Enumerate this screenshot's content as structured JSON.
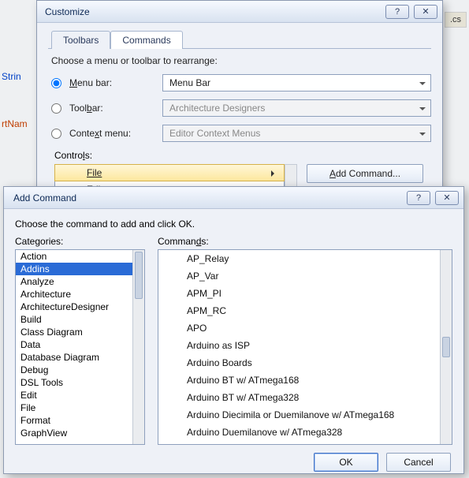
{
  "background": {
    "str": "Strin",
    "rtnam": "rtNam",
    "tab": ".cs"
  },
  "customize": {
    "title": "Customize",
    "tabs": {
      "toolbars": "Toolbars",
      "commands": "Commands"
    },
    "activeTab": "commands",
    "prompt": "Choose a menu or toolbar to rearrange:",
    "radios": {
      "menubar": {
        "label_pre": "",
        "key": "M",
        "label_post": "enu bar:",
        "value": "Menu Bar",
        "checked": true
      },
      "toolbar": {
        "label_pre": "Tool",
        "key": "b",
        "label_post": "ar:",
        "value": "Architecture Designers",
        "checked": false
      },
      "context": {
        "label_pre": "Conte",
        "key": "x",
        "label_post": "t menu:",
        "value": "Editor Context Menus",
        "checked": false
      }
    },
    "controls_label_pre": "Contro",
    "controls_label_key": "l",
    "controls_label_post": "s:",
    "controls_items": [
      "File",
      "Edit"
    ],
    "selected_control": 0,
    "add_command_btn_pre": "",
    "add_command_btn_key": "A",
    "add_command_btn_post": "dd Command..."
  },
  "addCommand": {
    "title": "Add Command",
    "prompt": "Choose the command to add and click OK.",
    "categories_label_pre": "Cate",
    "categories_label_key": "g",
    "categories_label_post": "ories:",
    "commands_label_pre": "Comman",
    "commands_label_key": "d",
    "commands_label_post": "s:",
    "categories": [
      "Action",
      "Addins",
      "Analyze",
      "Architecture",
      "ArchitectureDesigner",
      "Build",
      "Class Diagram",
      "Data",
      "Database Diagram",
      "Debug",
      "DSL Tools",
      "Edit",
      "File",
      "Format",
      "GraphView"
    ],
    "selected_category": 1,
    "commands": [
      "AP_Relay",
      "AP_Var",
      "APM_PI",
      "APM_RC",
      "APO",
      "Arduino as ISP",
      "Arduino Boards",
      "Arduino BT w/ ATmega168",
      "Arduino BT w/ ATmega328",
      "Arduino Diecimila or Duemilanove w/ ATmega168",
      "Arduino Duemilanove w/ ATmega328"
    ],
    "buttons": {
      "ok": "OK",
      "cancel": "Cancel"
    }
  }
}
